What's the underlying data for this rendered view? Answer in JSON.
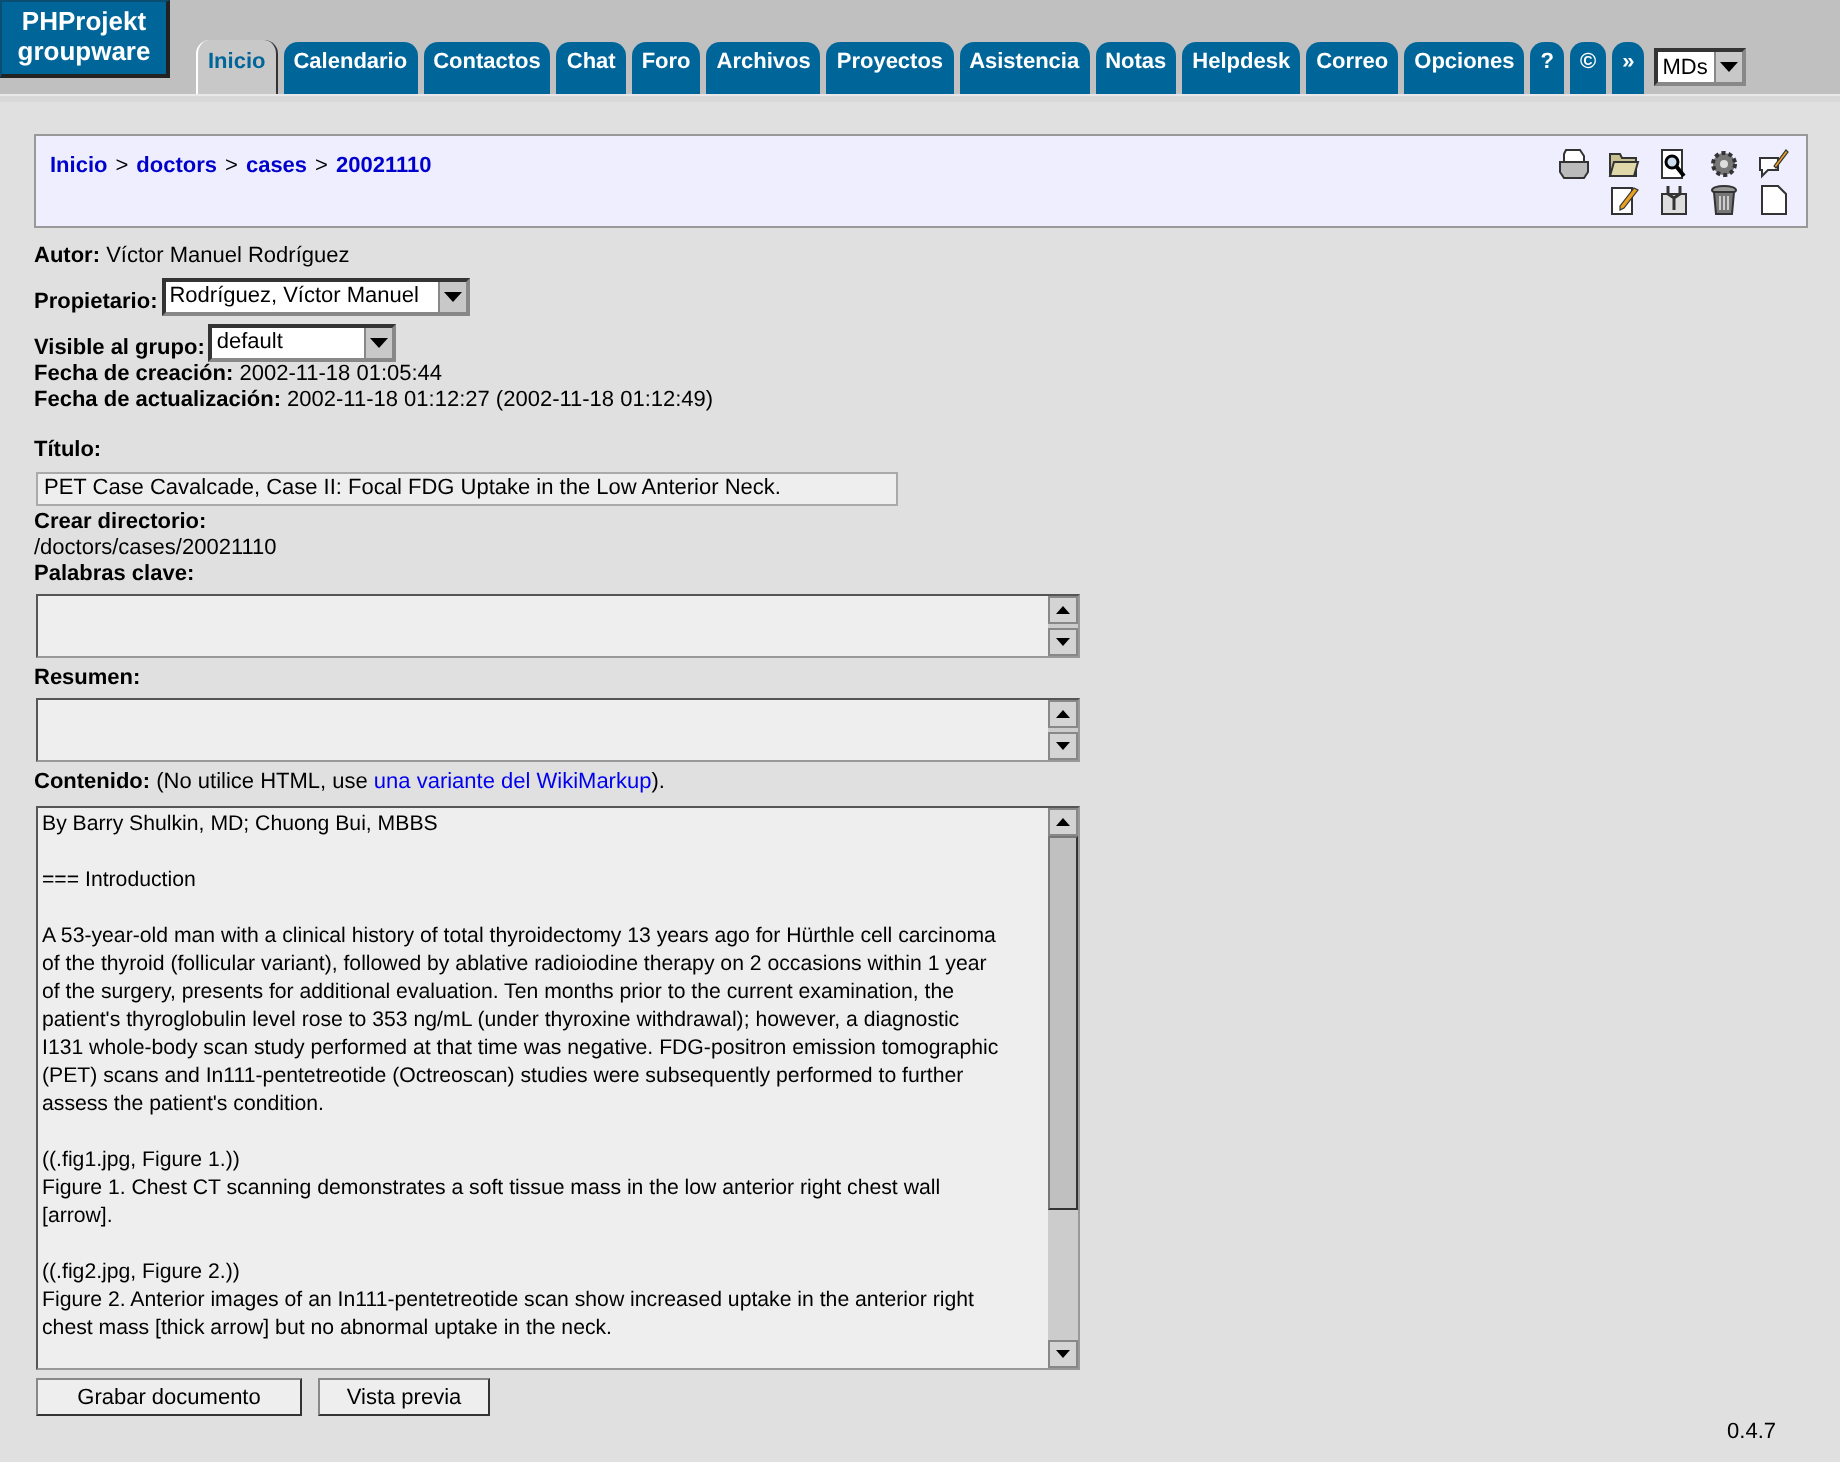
{
  "logo": {
    "lines": [
      "PHProjekt",
      "groupware"
    ]
  },
  "tabs": [
    {
      "label": "Inicio",
      "selected": true
    },
    {
      "label": "Calendario",
      "selected": false
    },
    {
      "label": "Contactos",
      "selected": false
    },
    {
      "label": "Chat",
      "selected": false
    },
    {
      "label": "Foro",
      "selected": false
    },
    {
      "label": "Archivos",
      "selected": false
    },
    {
      "label": "Proyectos",
      "selected": false
    },
    {
      "label": "Asistencia",
      "selected": false
    },
    {
      "label": "Notas",
      "selected": false
    },
    {
      "label": "Helpdesk",
      "selected": false
    },
    {
      "label": "Correo",
      "selected": false
    },
    {
      "label": "Opciones",
      "selected": false
    },
    {
      "label": "?",
      "selected": false
    },
    {
      "label": "©",
      "selected": false
    },
    {
      "label": "»",
      "selected": false
    }
  ],
  "group_select": {
    "value": "MDs"
  },
  "breadcrumb": {
    "separator": ">",
    "items": [
      "Inicio",
      "doctors",
      "cases",
      "20021110"
    ]
  },
  "autor": {
    "label": "Autor:",
    "value": "Víctor Manuel Rodríguez"
  },
  "propietario": {
    "label": "Propietario:",
    "value": "Rodríguez, Víctor Manuel"
  },
  "visible": {
    "label": "Visible al grupo:",
    "value": "default"
  },
  "creacion": {
    "label": "Fecha de creación:",
    "value": "2002-11-18 01:05:44"
  },
  "actualizacion": {
    "label": "Fecha de actualización:",
    "value": "2002-11-18 01:12:27 (2002-11-18 01:12:49)"
  },
  "titulo": {
    "label": "Título:",
    "value": "PET Case Cavalcade, Case II: Focal FDG Uptake in the Low Anterior Neck."
  },
  "directorio": {
    "label": "Crear directorio:",
    "value": "/doctors/cases/20021110"
  },
  "palabras": {
    "label": "Palabras clave:"
  },
  "resumen": {
    "label": "Resumen:"
  },
  "contenido": {
    "label": "Contenido:",
    "hint_before": "(No utilice HTML, use ",
    "hint_link": "una variante del WikiMarkup",
    "hint_after": ").",
    "blocks": [
      [
        "By Barry Shulkin, MD; Chuong Bui, MBBS"
      ],
      [
        "=== Introduction"
      ],
      [
        "A 53-year-old man with a clinical history of total thyroidectomy 13 years ago for Hürthle cell carcinoma",
        "of the thyroid (follicular variant), followed by ablative radioiodine therapy on 2 occasions within 1 year",
        "of the surgery, presents for additional evaluation. Ten months prior to the current examination, the",
        "patient's thyroglobulin level rose to 353 ng/mL (under thyroxine withdrawal); however, a diagnostic",
        "I131 whole-body scan study performed at that time was negative. FDG-positron emission tomographic",
        "(PET) scans and In111-pentetreotide (Octreoscan) studies were subsequently performed to further",
        "assess the patient's condition."
      ],
      [
        "((.fig1.jpg, Figure 1.))",
        "Figure 1. Chest CT scanning demonstrates a soft tissue mass in the low anterior right chest wall",
        "[arrow]."
      ],
      [
        "((.fig2.jpg, Figure 2.))",
        "Figure 2. Anterior images of an In111-pentetreotide scan show increased uptake in the anterior right",
        "chest mass [thick arrow] but no abnormal uptake in the neck."
      ]
    ]
  },
  "buttons": [
    "Grabar documento",
    "Vista previa"
  ],
  "version": "0.4.7"
}
